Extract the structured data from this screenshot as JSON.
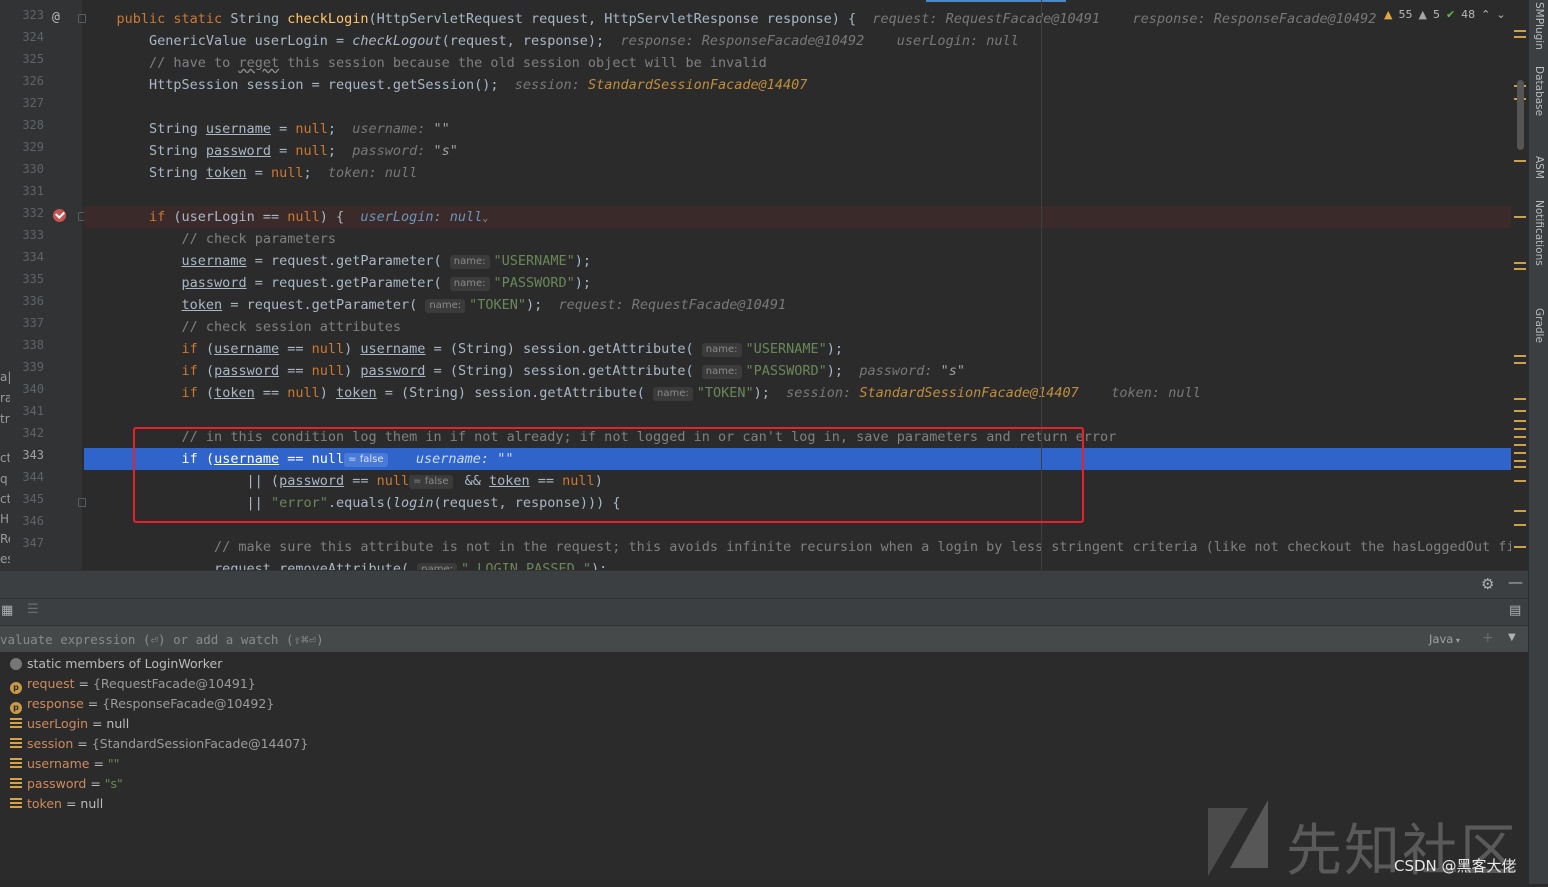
{
  "editor": {
    "lines": [
      {
        "no": "323"
      },
      {
        "no": "324"
      },
      {
        "no": "325"
      },
      {
        "no": "326"
      },
      {
        "no": "327"
      },
      {
        "no": "328"
      },
      {
        "no": "329"
      },
      {
        "no": "330"
      },
      {
        "no": "331"
      },
      {
        "no": "332"
      },
      {
        "no": "333"
      },
      {
        "no": "334"
      },
      {
        "no": "335"
      },
      {
        "no": "336"
      },
      {
        "no": "337"
      },
      {
        "no": "338"
      },
      {
        "no": "339"
      },
      {
        "no": "340"
      },
      {
        "no": "341"
      },
      {
        "no": "342"
      },
      {
        "no": "343"
      },
      {
        "no": "344"
      },
      {
        "no": "345"
      },
      {
        "no": "346"
      },
      {
        "no": "347"
      }
    ],
    "left_strip": [
      "a|",
      "ra",
      "tri",
      "ctl",
      "q",
      "ct|",
      "H",
      "Re",
      "es"
    ],
    "hints": {
      "name": "name:",
      "eq_false": "= false",
      "request_facade": "request: RequestFacade@10491",
      "response_facade": "response: ResponseFacade@10492",
      "userlogin_null": "userLogin: null",
      "session_label": "session:",
      "session_value": "StandardSessionFacade@14407",
      "username_label": "username:",
      "password_label": "password:",
      "token_null": "token: null"
    },
    "inspections": {
      "warnings": "55",
      "weak_warnings": "5",
      "typos": "48"
    }
  },
  "right_tools": [
    "SMPlugin",
    "Database",
    "ASM",
    "Notifications",
    "Gradle"
  ],
  "debugger": {
    "eval_placeholder": "valuate expression (⏎) or add a watch (⇧⌘⏎)",
    "language": "Java",
    "variables": [
      {
        "kind": "static",
        "name": "static members of LoginWorker",
        "eq": "",
        "value": ""
      },
      {
        "kind": "param",
        "name": "request",
        "eq": " = ",
        "value": "{RequestFacade@10491}"
      },
      {
        "kind": "param",
        "name": "response",
        "eq": " = ",
        "value": "{ResponseFacade@10492}"
      },
      {
        "kind": "field",
        "name": "userLogin",
        "eq": " = ",
        "value": "null"
      },
      {
        "kind": "field",
        "name": "session",
        "eq": " = ",
        "value": "{StandardSessionFacade@14407}"
      },
      {
        "kind": "field",
        "name": "username",
        "eq": " = ",
        "value": "\"\""
      },
      {
        "kind": "field",
        "name": "password",
        "eq": " = ",
        "value": "\"s\""
      },
      {
        "kind": "field",
        "name": "token",
        "eq": " = ",
        "value": "null"
      }
    ]
  },
  "watermark": {
    "site": "先知社区",
    "csdn": "CSDN @黑客大佬"
  },
  "colors": {
    "execution_line": "#2f65ca",
    "annotation_box": "#e8212a",
    "breakpoint": "#c75450"
  }
}
